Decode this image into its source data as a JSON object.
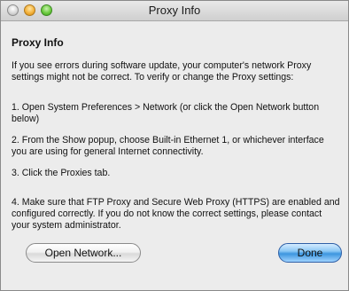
{
  "window": {
    "title": "Proxy Info"
  },
  "content": {
    "heading": "Proxy Info",
    "intro": "If you see errors during software update, your computer's network Proxy settings might not be correct. To verify or change the Proxy settings:",
    "steps": [
      "1. Open System Preferences > Network (or click the Open Network button below)",
      "2. From the Show popup, choose Built-in Ethernet 1, or whichever interface you are using for general Internet connectivity.",
      "3. Click the Proxies tab.",
      "4. Make sure that FTP Proxy and Secure Web Proxy (HTTPS) are enabled and configured correctly. If you do not know the correct settings, please contact your system administrator."
    ]
  },
  "buttons": {
    "open_network": "Open Network...",
    "done": "Done"
  },
  "colors": {
    "close": "#cfcfcf",
    "minimize": "#f4b23c",
    "zoom": "#6ccb3f",
    "default_button": "#3d96df"
  }
}
